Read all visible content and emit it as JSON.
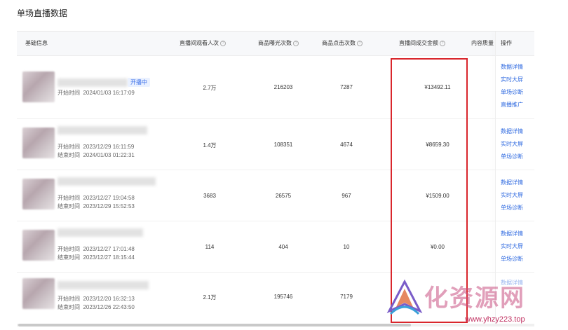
{
  "page_title": "单场直播数据",
  "headers": {
    "basic": "基础信息",
    "viewers": "直播间观看人次",
    "exposure": "商品曝光次数",
    "clicks": "商品点击次数",
    "gmv": "直播间成交金额",
    "quality": "内容质量",
    "ops": "操作"
  },
  "rows": [
    {
      "badge": "开播中",
      "start_label": "开始时间",
      "start": "2024/01/03 16:17:09",
      "end_label": "",
      "end": "",
      "viewers": "2.7万",
      "exposure": "216203",
      "clicks": "7287",
      "gmv": "¥13492.11",
      "actions": [
        "数据详情",
        "实时大屏",
        "单场诊断",
        "直播推广"
      ]
    },
    {
      "badge": "",
      "start_label": "开始时间",
      "start": "2023/12/29 16:11:59",
      "end_label": "结束时间",
      "end": "2024/01/03 01:22:31",
      "viewers": "1.4万",
      "exposure": "108351",
      "clicks": "4674",
      "gmv": "¥8659.30",
      "actions": [
        "数据详情",
        "实时大屏",
        "单场诊断"
      ]
    },
    {
      "badge": "",
      "start_label": "开始时间",
      "start": "2023/12/27 19:04:58",
      "end_label": "结束时间",
      "end": "2023/12/29 15:52:53",
      "viewers": "3683",
      "exposure": "26575",
      "clicks": "967",
      "gmv": "¥1509.00",
      "actions": [
        "数据详情",
        "实时大屏",
        "单场诊断"
      ]
    },
    {
      "badge": "",
      "start_label": "开始时间",
      "start": "2023/12/27 17:01:48",
      "end_label": "结束时间",
      "end": "2023/12/27 18:15:44",
      "viewers": "114",
      "exposure": "404",
      "clicks": "10",
      "gmv": "¥0.00",
      "actions": [
        "数据详情",
        "实时大屏",
        "单场诊断"
      ]
    },
    {
      "badge": "",
      "start_label": "开始时间",
      "start": "2023/12/20 16:32:13",
      "end_label": "结束时间",
      "end": "2023/12/26 22:43:50",
      "viewers": "2.1万",
      "exposure": "195746",
      "clicks": "7179",
      "gmv": "",
      "actions": [
        "数据详情"
      ]
    }
  ],
  "watermark": {
    "text": "化资源网",
    "url": "www.yhzy223.top"
  }
}
